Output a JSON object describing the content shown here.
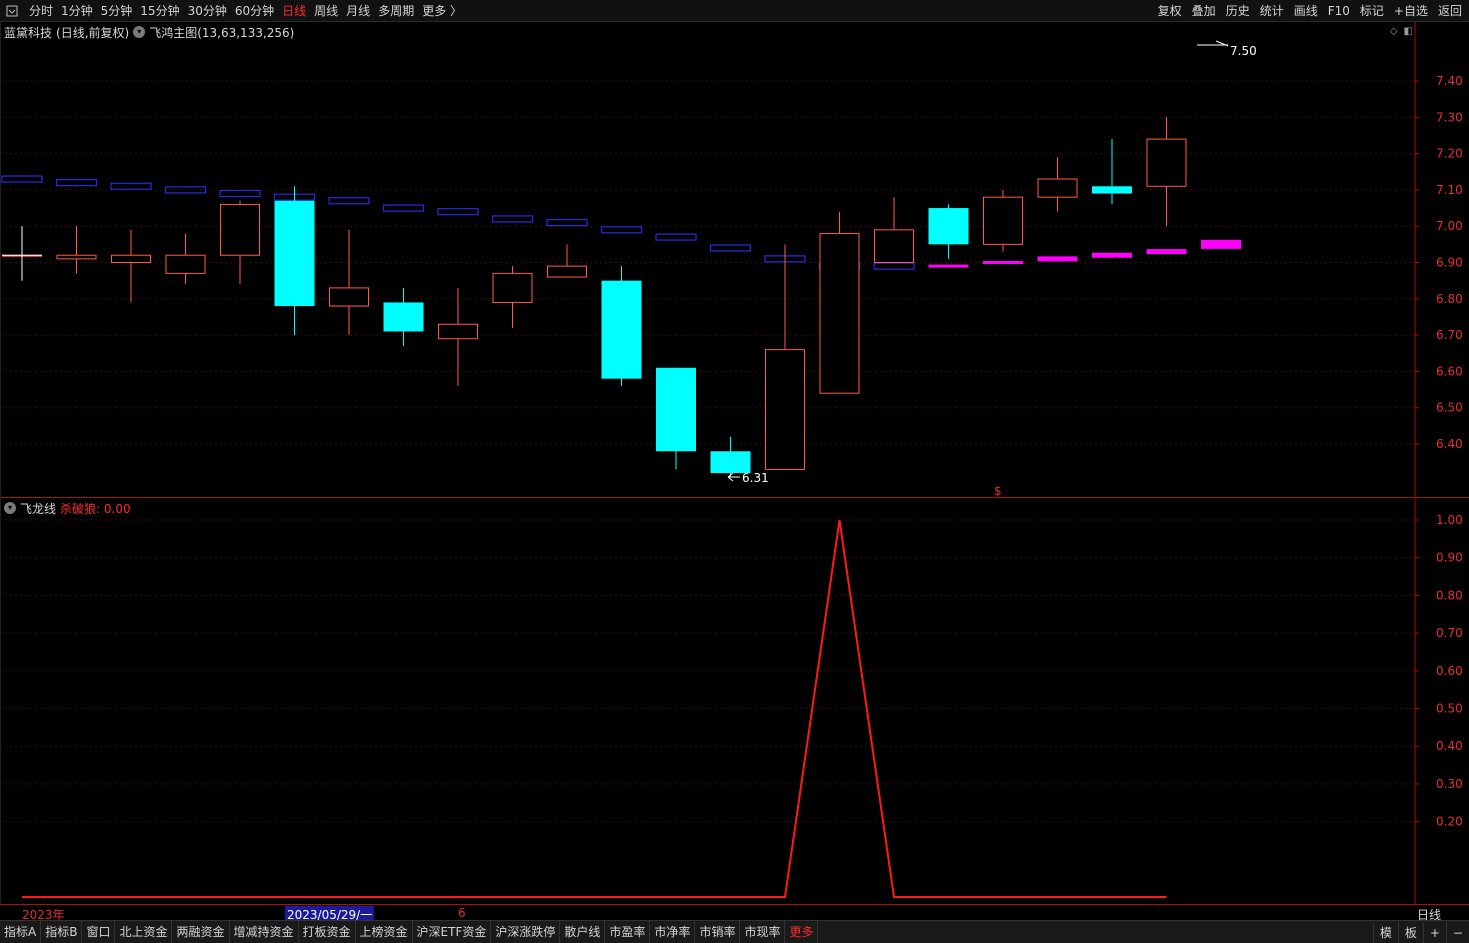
{
  "toolbar": {
    "periods": [
      {
        "label": "分时",
        "active": false
      },
      {
        "label": "1分钟",
        "active": false
      },
      {
        "label": "5分钟",
        "active": false
      },
      {
        "label": "15分钟",
        "active": false
      },
      {
        "label": "30分钟",
        "active": false
      },
      {
        "label": "60分钟",
        "active": false
      },
      {
        "label": "日线",
        "active": true
      },
      {
        "label": "周线",
        "active": false
      },
      {
        "label": "月线",
        "active": false
      },
      {
        "label": "多周期",
        "active": false
      },
      {
        "label": "更多 〉",
        "active": false
      }
    ],
    "tools": [
      "复权",
      "叠加",
      "历史",
      "统计",
      "画线",
      "F10",
      "标记",
      "+自选",
      "返回"
    ]
  },
  "main_chart": {
    "stock_name": "蓝黛科技",
    "period_info": "(日线,前复权)",
    "indicator": "飞鸿主图(13,63,133,256)",
    "high_label": "7.50",
    "low_label": "6.31",
    "marker_symbol": "$",
    "axis_ticks": [
      "7.40",
      "7.30",
      "7.20",
      "7.10",
      "7.00",
      "6.90",
      "6.80",
      "6.70",
      "6.60",
      "6.50",
      "6.40"
    ]
  },
  "sub_chart": {
    "indicator": "飞龙线",
    "value_label": "杀破狼: 0.00",
    "axis_ticks": [
      "1.00",
      "0.90",
      "0.80",
      "0.70",
      "0.60",
      "0.50",
      "0.40",
      "0.30",
      "0.20"
    ]
  },
  "date_axis": {
    "year_label": "2023年",
    "cursor_label": "2023/05/29/一",
    "month_label": "6",
    "period_indicator": "日线"
  },
  "bottom_tabs": [
    {
      "label": "指标A",
      "active": false
    },
    {
      "label": "指标B",
      "active": false
    },
    {
      "label": "窗口",
      "active": false
    },
    {
      "label": "北上资金",
      "active": false
    },
    {
      "label": "两融资金",
      "active": false
    },
    {
      "label": "增减持资金",
      "active": false
    },
    {
      "label": "打板资金",
      "active": false
    },
    {
      "label": "上榜资金",
      "active": false
    },
    {
      "label": "沪深ETF资金",
      "active": false
    },
    {
      "label": "沪深涨跌停",
      "active": false
    },
    {
      "label": "散户线",
      "active": false
    },
    {
      "label": "市盈率",
      "active": false
    },
    {
      "label": "市净率",
      "active": false
    },
    {
      "label": "市销率",
      "active": false
    },
    {
      "label": "市现率",
      "active": false
    },
    {
      "label": "更多",
      "active": true
    }
  ],
  "bottom_right": [
    "模",
    "板",
    "+",
    "−"
  ],
  "colors": {
    "up": "#ff5a4a",
    "down": "#00ffff",
    "ma_blue": "#2a2ae0",
    "ma_magenta": "#ff00ff",
    "axis": "#aa1010",
    "line": "#ff1a1a"
  },
  "chart_data": {
    "type": "candlestick",
    "y_range": [
      6.3,
      7.5
    ],
    "candles": [
      {
        "open": 6.92,
        "close": 6.92,
        "high": 7.0,
        "low": 6.85,
        "crosshair": true
      },
      {
        "open": 6.91,
        "close": 6.92,
        "high": 7.0,
        "low": 6.87
      },
      {
        "open": 6.9,
        "close": 6.92,
        "high": 6.99,
        "low": 6.79
      },
      {
        "open": 6.87,
        "close": 6.92,
        "high": 6.98,
        "low": 6.84
      },
      {
        "open": 6.92,
        "close": 7.06,
        "high": 7.07,
        "low": 6.84
      },
      {
        "open": 7.07,
        "close": 6.78,
        "high": 7.11,
        "low": 6.7
      },
      {
        "open": 6.78,
        "close": 6.83,
        "high": 6.99,
        "low": 6.7
      },
      {
        "open": 6.79,
        "close": 6.71,
        "high": 6.83,
        "low": 6.67
      },
      {
        "open": 6.69,
        "close": 6.73,
        "high": 6.83,
        "low": 6.56
      },
      {
        "open": 6.79,
        "close": 6.87,
        "high": 6.89,
        "low": 6.72
      },
      {
        "open": 6.86,
        "close": 6.89,
        "high": 6.95,
        "low": 6.86
      },
      {
        "open": 6.85,
        "close": 6.58,
        "high": 6.89,
        "low": 6.56
      },
      {
        "open": 6.61,
        "close": 6.38,
        "high": 6.61,
        "low": 6.33
      },
      {
        "open": 6.38,
        "close": 6.32,
        "high": 6.42,
        "low": 6.31
      },
      {
        "open": 6.33,
        "close": 6.66,
        "high": 6.95,
        "low": 6.33
      },
      {
        "open": 6.54,
        "close": 6.98,
        "high": 7.04,
        "low": 6.54
      },
      {
        "open": 6.9,
        "close": 6.99,
        "high": 7.08,
        "low": 6.9
      },
      {
        "open": 7.05,
        "close": 6.95,
        "high": 7.06,
        "low": 6.91
      },
      {
        "open": 6.95,
        "close": 7.08,
        "high": 7.1,
        "low": 6.93
      },
      {
        "open": 7.08,
        "close": 7.13,
        "high": 7.19,
        "low": 7.04
      },
      {
        "open": 7.11,
        "close": 7.09,
        "high": 7.24,
        "low": 7.06
      },
      {
        "open": 7.11,
        "close": 7.24,
        "high": 7.3,
        "low": 7.0
      }
    ],
    "ma_blue": [
      7.13,
      7.12,
      7.11,
      7.1,
      7.09,
      7.08,
      7.07,
      7.05,
      7.04,
      7.02,
      7.01,
      6.99,
      6.97,
      6.94,
      6.91,
      6.89,
      6.89
    ],
    "ma_magenta": [
      null,
      null,
      null,
      null,
      null,
      null,
      null,
      null,
      null,
      null,
      null,
      null,
      null,
      null,
      null,
      null,
      null,
      6.89,
      6.9,
      6.91,
      6.92,
      6.93,
      6.95
    ],
    "sub_line": {
      "ylim": [
        0,
        1.0
      ],
      "values": [
        0,
        0,
        0,
        0,
        0,
        0,
        0,
        0,
        0,
        0,
        0,
        0,
        0,
        0,
        0,
        1.0,
        0,
        0,
        0,
        0,
        0,
        0
      ]
    }
  }
}
